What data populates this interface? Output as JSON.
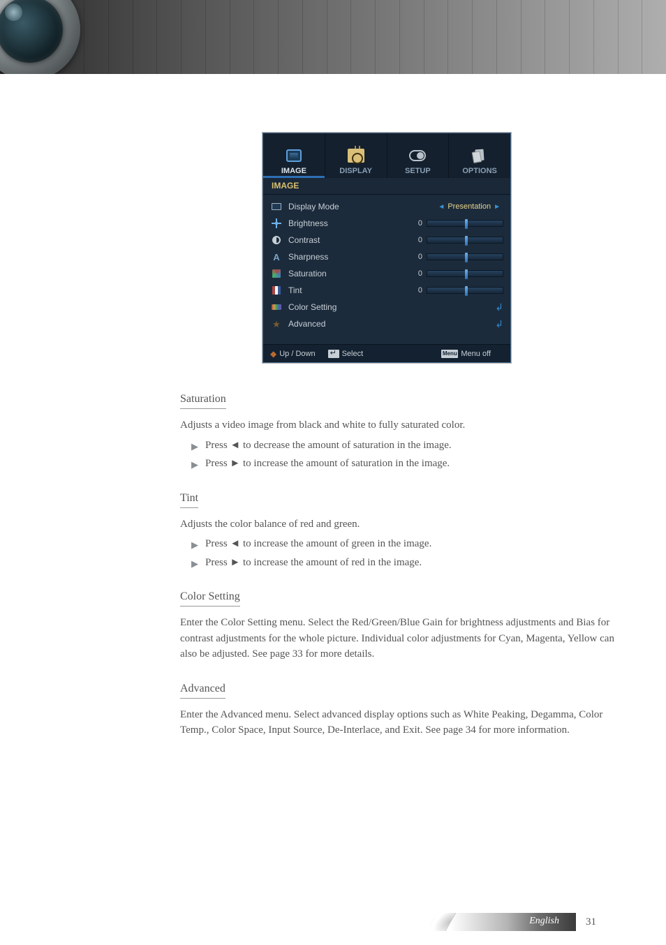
{
  "osd": {
    "tabs": [
      "IMAGE",
      "DISPLAY",
      "SETUP",
      "OPTIONS"
    ],
    "active_tab": 0,
    "section_title": "IMAGE",
    "rows": {
      "display_mode": {
        "label": "Display Mode",
        "value": "Presentation"
      },
      "brightness": {
        "label": "Brightness",
        "value": "0"
      },
      "contrast": {
        "label": "Contrast",
        "value": "0"
      },
      "sharpness": {
        "label": "Sharpness",
        "value": "0"
      },
      "saturation": {
        "label": "Saturation",
        "value": "0"
      },
      "tint": {
        "label": "Tint",
        "value": "0"
      },
      "color_setting": {
        "label": "Color Setting"
      },
      "advanced": {
        "label": "Advanced"
      }
    },
    "footer": {
      "updown": "Up / Down",
      "select": "Select",
      "menu_key": "Menu",
      "menu_off": "Menu off"
    }
  },
  "body": {
    "sat_title": "Saturation",
    "sat_desc": "Adjusts a video image from black and white to fully saturated color.",
    "sat_dec": "Press ◄ to decrease the amount of saturation in the image.",
    "sat_inc": "Press ► to increase the amount of saturation in the image.",
    "tint_title": "Tint",
    "tint_desc": "Adjusts the color balance of red and green.",
    "tint_green": "Press ◄ to increase the amount of green in the image.",
    "tint_red": "Press ► to increase the amount of red in the image.",
    "color_title": "Color Setting",
    "color_desc": "Enter the Color Setting menu. Select the Red/Green/Blue Gain for brightness adjustments and Bias for contrast adjustments for the whole picture. Individual color adjustments for Cyan, Magenta, Yellow can also be adjusted. See page 33 for more details.",
    "adv_title": "Advanced",
    "adv_desc": "Enter the Advanced menu. Select advanced display options such as White Peaking, Degamma, Color Temp., Color Space, Input Source, De-Interlace, and Exit. See page 34 for more information."
  },
  "footer": {
    "label": "English",
    "page": "31"
  }
}
